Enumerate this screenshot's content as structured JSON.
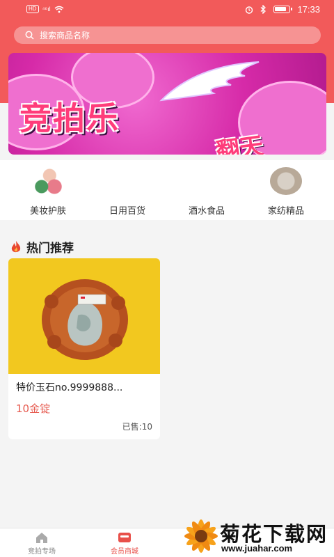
{
  "status_bar": {
    "network_left": "HD",
    "signal_text": "⁴⁶ıl",
    "time": "17:33"
  },
  "search": {
    "placeholder": "搜索商品名称",
    "icon": "search-icon"
  },
  "banner": {
    "title": "竞拍乐",
    "title2": "翻天"
  },
  "categories": [
    {
      "label": "美妆护肤",
      "icon": "cosmetic-sponge-image"
    },
    {
      "label": "日用百货",
      "icon": ""
    },
    {
      "label": "酒水食品",
      "icon": ""
    },
    {
      "label": "家纺精品",
      "icon": "bedding-image"
    }
  ],
  "hot": {
    "title": "热门推荐",
    "icon": "fire-icon",
    "products": [
      {
        "title": "特价玉石no.9999888...",
        "price": "10金锭",
        "sold": "已售:10"
      }
    ]
  },
  "tabbar": {
    "items": [
      {
        "label": "竞拍专场",
        "icon": "home-icon",
        "active": false
      },
      {
        "label": "会员商城",
        "icon": "store-icon",
        "active": true
      }
    ]
  },
  "watermark": {
    "text": "菊花下载网",
    "url": "www.juahar.com"
  },
  "colors": {
    "header": "#f25a5a",
    "accent": "#e65a4f",
    "banner": "#d62aa8"
  }
}
